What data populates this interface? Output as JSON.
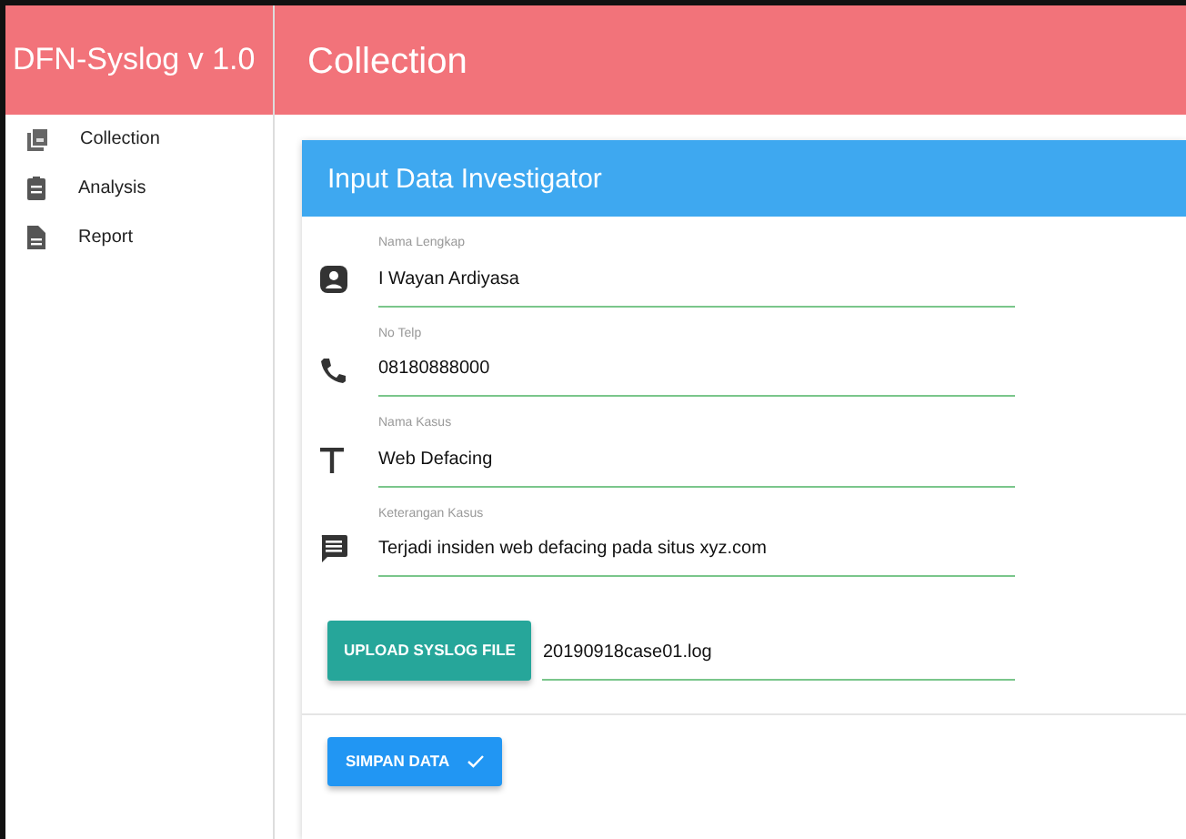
{
  "sidebar": {
    "title": "DFN-Syslog v 1.0",
    "items": [
      {
        "label": "Collection",
        "kind": "collection"
      },
      {
        "label": "Analysis",
        "kind": "clipboard"
      },
      {
        "label": "Report",
        "kind": "document"
      }
    ]
  },
  "page_title": "Collection",
  "card": {
    "title": "Input Data Investigator",
    "fields": [
      {
        "label": "Nama Lengkap",
        "value": "I Wayan Ardiyasa",
        "kind": "person"
      },
      {
        "label": "No Telp",
        "value": "08180888000",
        "kind": "phone"
      },
      {
        "label": "Nama Kasus",
        "value": "Web Defacing",
        "kind": "text"
      },
      {
        "label": "Keterangan Kasus",
        "value": "Terjadi insiden web defacing pada situs xyz.com",
        "kind": "comment"
      }
    ],
    "upload": {
      "button": "UPLOAD SYSLOG FILE",
      "value": "20190918case01.log"
    },
    "save_button": "SIMPAN DATA"
  }
}
